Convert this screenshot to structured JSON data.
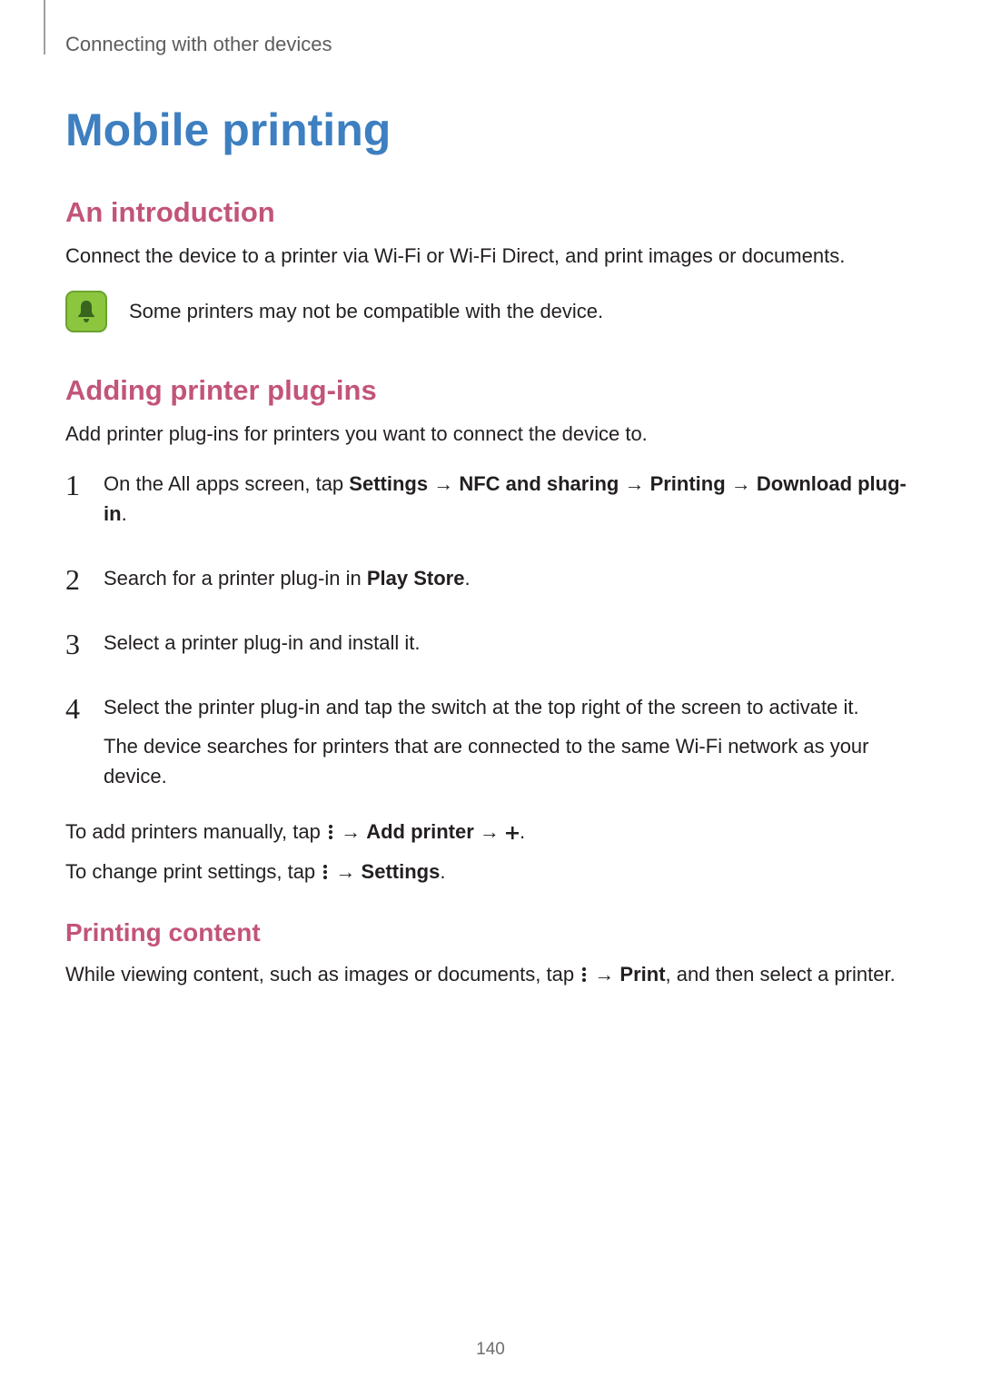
{
  "breadcrumb": "Connecting with other devices",
  "title": "Mobile printing",
  "section_intro": {
    "heading": "An introduction",
    "body": "Connect the device to a printer via Wi-Fi or Wi-Fi Direct, and print images or documents.",
    "note": "Some printers may not be compatible with the device."
  },
  "section_plugins": {
    "heading": "Adding printer plug-ins",
    "body": "Add printer plug-ins for printers you want to connect the device to.",
    "steps": {
      "s1": {
        "pre": "On the All apps screen, tap ",
        "b1": "Settings",
        "a1": " → ",
        "b2": "NFC and sharing",
        "a2": " → ",
        "b3": "Printing",
        "a3": " → ",
        "b4": "Download plug-in",
        "post": "."
      },
      "s2": {
        "pre": "Search for a printer plug-in in ",
        "b1": "Play Store",
        "post": "."
      },
      "s3": {
        "text": "Select a printer plug-in and install it."
      },
      "s4": {
        "line1": "Select the printer plug-in and tap the switch at the top right of the screen to activate it.",
        "line2": "The device searches for printers that are connected to the same Wi-Fi network as your device."
      }
    },
    "after": {
      "p1": {
        "pre": "To add printers manually, tap ",
        "arrow1": " → ",
        "b1": "Add printer",
        "arrow2": " → ",
        "post": "."
      },
      "p2": {
        "pre": "To change print settings, tap ",
        "arrow1": " → ",
        "b1": "Settings",
        "post": "."
      }
    }
  },
  "section_printing": {
    "heading": "Printing content",
    "body": {
      "pre": "While viewing content, such as images or documents, tap ",
      "arrow": " → ",
      "b1": "Print",
      "post": ", and then select a printer."
    }
  },
  "page_number": "140"
}
